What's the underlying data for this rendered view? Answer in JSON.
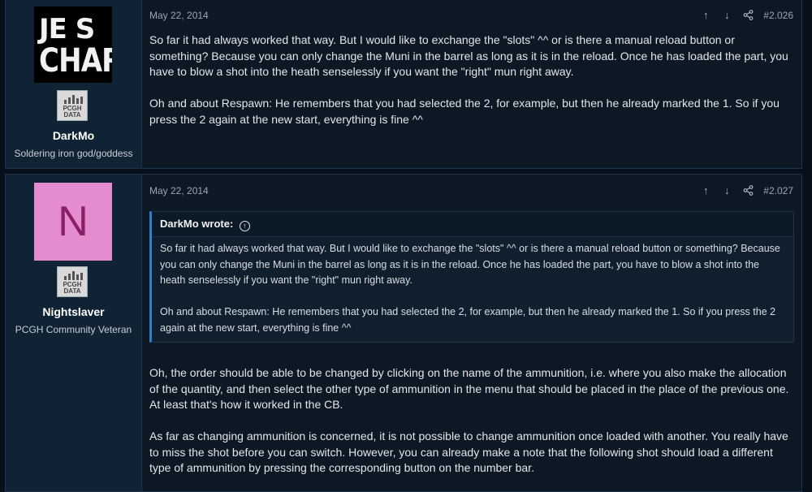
{
  "posts": [
    {
      "author": "DarkMo",
      "user_title": "Soldering iron god/goddess",
      "avatar_text_line1": "JE S",
      "avatar_text_line2": "CHAR",
      "badge_line1": "PCGH",
      "badge_line2": "DATA",
      "date": "May 22, 2014",
      "post_number": "#2.026",
      "paragraphs": [
        "So far it had always worked that way. But I would like to exchange the \"slots\" ^^ or is there a manual reload button or something? Because you can only change the Muni in the barrel as long as it is in the reload. Once he has loaded the part, you have to blow a shot into the heath senselessly if you want the \"right\" mun right away.",
        "Oh and about Respawn: He remembers that you had selected the 2, for example, but then he already marked the 1. So if you press the 2 again at the new start, everything is fine ^^"
      ]
    },
    {
      "author": "Nightslaver",
      "user_title": "PCGH Community Veteran",
      "avatar_letter": "N",
      "badge_line1": "PCGH",
      "badge_line2": "DATA",
      "date": "May 22, 2014",
      "post_number": "#2.027",
      "quote": {
        "header": "DarkMo wrote:",
        "paragraphs": [
          "So far it had always worked that way. But I would like to exchange the \"slots\" ^^ or is there a manual reload button or something? Because you can only change the Muni in the barrel as long as it is in the reload. Once he has loaded the part, you have to blow a shot into the heath senselessly if you want the \"right\" mun right away.",
          "Oh and about Respawn: He remembers that you had selected the 2, for example, but then he already marked the 1. So if you press the 2 again at the new start, everything is fine ^^"
        ]
      },
      "paragraphs": [
        "Oh, the order should be able to be changed by clicking on the name of the ammunition, i.e. where you also make the allocation of the quantity, and then select the other type of ammunition in the menu that should be placed in the place of the previous one. At least that's how it worked in the CB.",
        "As far as changing ammunition is concerned, it is not possible to change ammunition once loaded with another. You really have to miss the shot before you can switch. However, you can already make a note that the following shot should load a different type of ammunition by pressing the corresponding button on the number bar."
      ]
    }
  ],
  "icons": {
    "upvote": "arrow-up-icon",
    "downvote": "arrow-down-icon",
    "share": "share-icon",
    "quote_jump": "circle-arrow-up-icon"
  },
  "colors": {
    "background": "#07101a",
    "post_bg": "#0c1824",
    "user_column_bg": "#0f2335",
    "quote_accent": "#2f7fd1",
    "avatar_pink": "#e48ccf"
  }
}
